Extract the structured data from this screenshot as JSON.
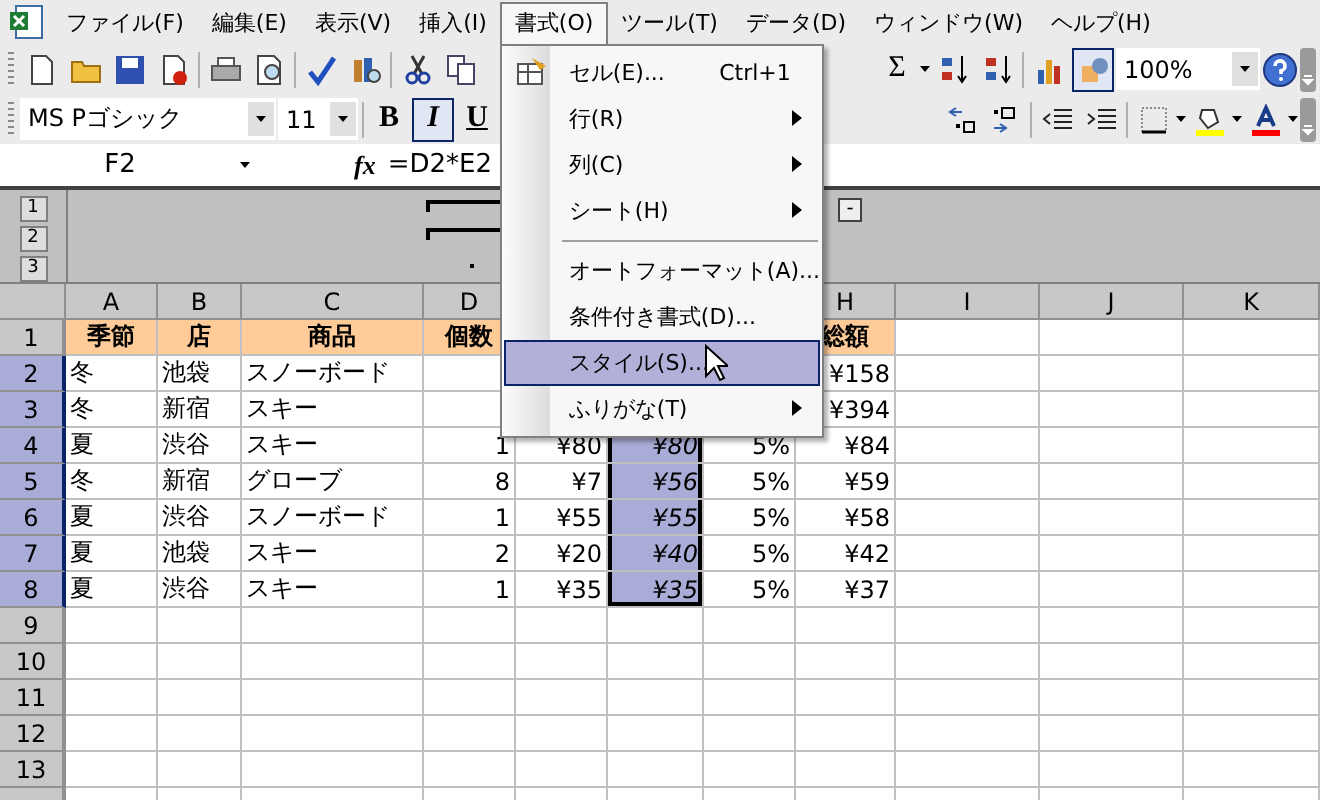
{
  "menu_bar": [
    {
      "label": "ファイル(F)",
      "selected": false
    },
    {
      "label": "編集(E)",
      "selected": false
    },
    {
      "label": "表示(V)",
      "selected": false
    },
    {
      "label": "挿入(I)",
      "selected": false
    },
    {
      "label": "書式(O)",
      "selected": true
    },
    {
      "label": "ツール(T)",
      "selected": false
    },
    {
      "label": "データ(D)",
      "selected": false
    },
    {
      "label": "ウィンドウ(W)",
      "selected": false
    },
    {
      "label": "ヘルプ(H)",
      "selected": false
    }
  ],
  "format_menu": [
    {
      "kind": "item",
      "label": "セル(E)...",
      "shortcut": "Ctrl+1",
      "has_icon": true,
      "submenu": false,
      "selected": false
    },
    {
      "kind": "item",
      "label": "行(R)",
      "submenu": true,
      "selected": false
    },
    {
      "kind": "item",
      "label": "列(C)",
      "submenu": true,
      "selected": false
    },
    {
      "kind": "item",
      "label": "シート(H)",
      "submenu": true,
      "selected": false
    },
    {
      "kind": "separator"
    },
    {
      "kind": "item",
      "label": "オートフォーマット(A)...",
      "submenu": false,
      "selected": false
    },
    {
      "kind": "item",
      "label": "条件付き書式(D)...",
      "submenu": false,
      "selected": false
    },
    {
      "kind": "item",
      "label": "スタイル(S)...",
      "submenu": false,
      "selected": true
    },
    {
      "kind": "item",
      "label": "ふりがな(T)",
      "submenu": true,
      "selected": false
    }
  ],
  "standard_toolbar": {
    "left": [
      {
        "kind": "new",
        "pressed": false
      },
      {
        "kind": "open",
        "pressed": false
      },
      {
        "kind": "save",
        "pressed": false
      },
      {
        "kind": "permission",
        "pressed": false
      },
      {
        "kind": "sep"
      },
      {
        "kind": "print",
        "pressed": false
      },
      {
        "kind": "preview",
        "pressed": false
      },
      {
        "kind": "sep"
      },
      {
        "kind": "spelling",
        "pressed": false
      },
      {
        "kind": "research",
        "pressed": false
      },
      {
        "kind": "sep"
      },
      {
        "kind": "cut",
        "pressed": false
      },
      {
        "kind": "copy",
        "pressed": false
      }
    ],
    "autosum": "Σ",
    "right": [
      {
        "kind": "sort-asc",
        "pressed": false
      },
      {
        "kind": "sort-desc",
        "pressed": false
      },
      {
        "kind": "sep"
      },
      {
        "kind": "chart",
        "pressed": false
      },
      {
        "kind": "drawing",
        "pressed": true
      }
    ],
    "zoom": "100%"
  },
  "format_toolbar": {
    "font": "MS Pゴシック",
    "size": "11",
    "styles": [
      {
        "label": "B",
        "pressed": false
      },
      {
        "label": "I",
        "pressed": true
      },
      {
        "label": "U",
        "pressed": false
      }
    ],
    "right": [
      {
        "kind": "inc-decimal",
        "pressed": false
      },
      {
        "kind": "dec-decimal",
        "pressed": false
      },
      {
        "kind": "sep"
      },
      {
        "kind": "dec-indent",
        "pressed": false
      },
      {
        "kind": "inc-indent",
        "pressed": false
      },
      {
        "kind": "sep"
      },
      {
        "kind": "borders",
        "pressed": false
      },
      {
        "kind": "fill-color",
        "pressed": false
      },
      {
        "kind": "font-color",
        "pressed": false
      }
    ]
  },
  "formula_bar": {
    "name_box": "F2",
    "function_label": "fx",
    "formula": "=D2*E2"
  },
  "outline": {
    "levels": [
      "1",
      "2",
      "3"
    ],
    "collapse_button": "-"
  },
  "sheet": {
    "columns": [
      {
        "label": "A",
        "kind": "text",
        "selected": false
      },
      {
        "label": "B",
        "kind": "text",
        "selected": false
      },
      {
        "label": "C",
        "kind": "text",
        "selected": false
      },
      {
        "label": "D",
        "kind": "number",
        "selected": false
      },
      {
        "kind": "number",
        "selected": false
      },
      {
        "kind": "number",
        "selected": true
      },
      {
        "kind": "number",
        "selected": false
      },
      {
        "label": "H",
        "kind": "number",
        "selected": false
      },
      {
        "label": "I",
        "kind": "text",
        "selected": false
      },
      {
        "label": "J",
        "kind": "text",
        "selected": false
      },
      {
        "label": "K",
        "kind": "text",
        "selected": false
      }
    ],
    "rows": [
      {
        "label": "1",
        "kind": "header",
        "selected": false,
        "cells": [
          "季節",
          "店",
          "商品",
          "個数",
          null,
          null,
          null,
          "総額"
        ]
      },
      {
        "label": "2",
        "kind": "data",
        "selected": true,
        "cells": [
          "冬",
          "池袋",
          "スノーボード",
          null,
          null,
          null,
          null,
          "¥158"
        ]
      },
      {
        "label": "3",
        "kind": "data",
        "selected": true,
        "cells": [
          "冬",
          "新宿",
          "スキー",
          null,
          null,
          null,
          null,
          "¥394"
        ]
      },
      {
        "label": "4",
        "kind": "data",
        "selected": true,
        "cells": [
          "夏",
          "渋谷",
          "スキー",
          "1",
          "¥80",
          "¥80",
          "5%",
          "¥84"
        ]
      },
      {
        "label": "5",
        "kind": "data",
        "selected": true,
        "cells": [
          "冬",
          "新宿",
          "グローブ",
          "8",
          "¥7",
          "¥56",
          "5%",
          "¥59"
        ]
      },
      {
        "label": "6",
        "kind": "data",
        "selected": true,
        "cells": [
          "夏",
          "渋谷",
          "スノーボード",
          "1",
          "¥55",
          "¥55",
          "5%",
          "¥58"
        ]
      },
      {
        "label": "7",
        "kind": "data",
        "selected": true,
        "cells": [
          "夏",
          "池袋",
          "スキー",
          "2",
          "¥20",
          "¥40",
          "5%",
          "¥42"
        ]
      },
      {
        "label": "8",
        "kind": "data",
        "selected": true,
        "cells": [
          "夏",
          "渋谷",
          "スキー",
          "1",
          "¥35",
          "¥35",
          "5%",
          "¥37"
        ]
      },
      {
        "label": "9",
        "kind": "data",
        "selected": false
      },
      {
        "label": "10",
        "kind": "data",
        "selected": false
      },
      {
        "label": "11",
        "kind": "data",
        "selected": false
      },
      {
        "label": "12",
        "kind": "data",
        "selected": false
      },
      {
        "label": "13",
        "kind": "data",
        "selected": false
      },
      {
        "kind": "data",
        "selected": false
      }
    ]
  }
}
